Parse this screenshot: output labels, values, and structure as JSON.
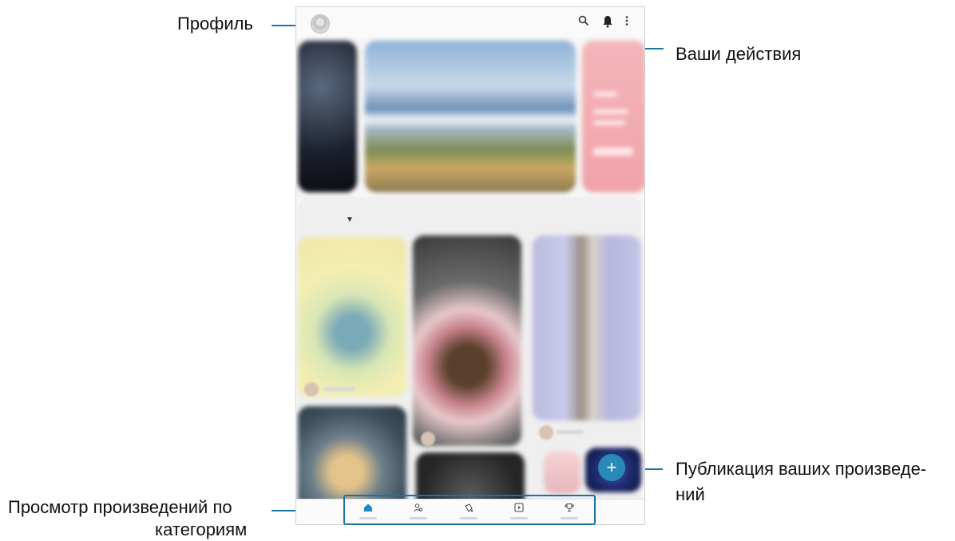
{
  "callouts": {
    "profile": "Профиль",
    "activity": "Ваши действия",
    "publish_line1": "Публикация ваших произведе-",
    "publish_line2": "ний",
    "browse_line1": "Просмотр произведений по",
    "browse_line2": "категориям"
  },
  "colors": {
    "accent": "#1a73a8",
    "fab": "#2a8ab7"
  },
  "icons": {
    "search": "search-icon",
    "bell": "bell-icon",
    "more": "more-vert-icon",
    "fab": "plus-icon",
    "nav": [
      "home-icon",
      "people-icon",
      "palette-icon",
      "play-icon",
      "trophy-icon"
    ]
  },
  "fab": {
    "symbol": "+"
  }
}
